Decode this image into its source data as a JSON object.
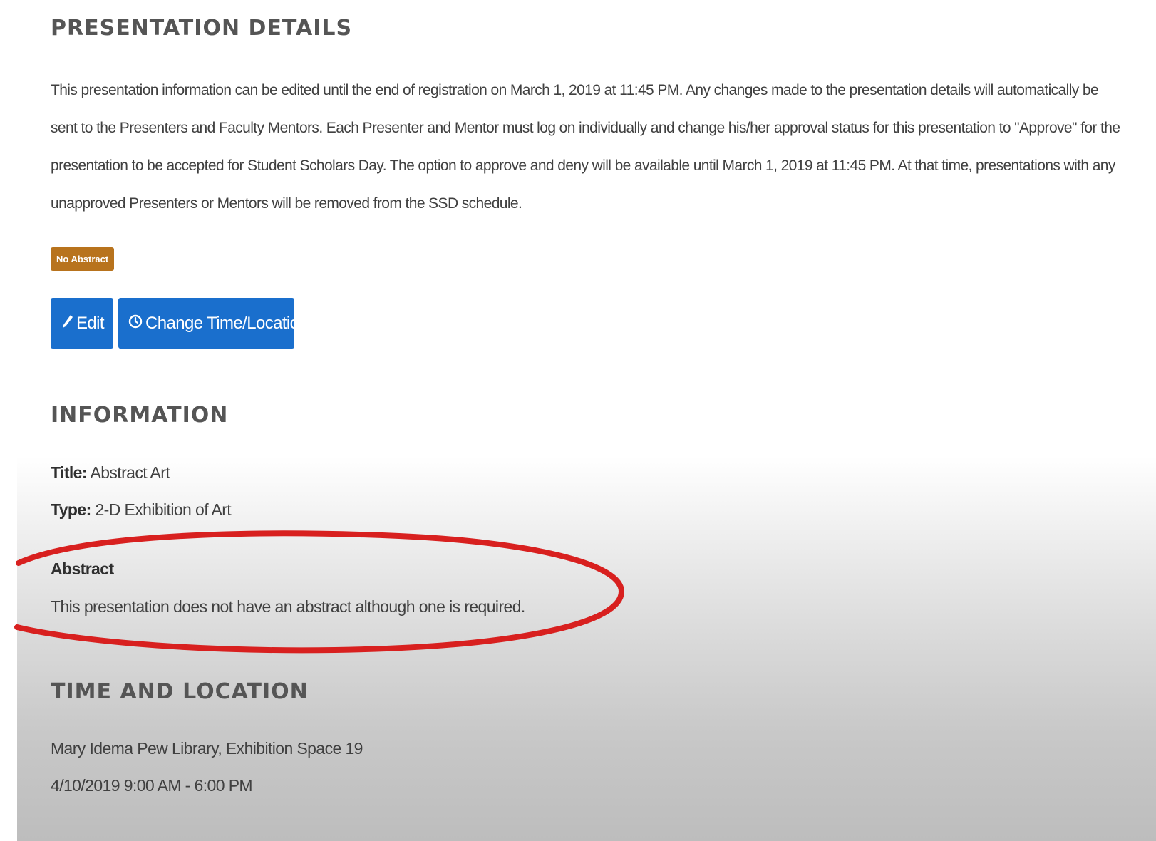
{
  "presentation_details": {
    "heading": "PRESENTATION DETAILS",
    "intro": "This presentation information can be edited until the end of registration on March 1, 2019 at 11:45 PM. Any changes made to the presentation details will automatically be sent to the Presenters and Faculty Mentors. Each Presenter and Mentor must log on individually and change his/her approval status for this presentation to \"Approve\" for the presentation to be accepted for Student Scholars Day. The option to approve and deny will be available until March 1, 2019 at 11:45 PM. At that time, presentations with any unapproved Presenters or Mentors will be removed from the SSD schedule.",
    "badge": "No Abstract",
    "badge_color": "#b8731d",
    "buttons": {
      "edit_label": "Edit",
      "edit_icon": "pencil-icon",
      "change_label": "Change Time/Location",
      "change_icon": "clock-icon",
      "color": "#1a6fcd"
    }
  },
  "information": {
    "heading": "INFORMATION",
    "title_label": "Title:",
    "title_value": "Abstract Art",
    "type_label": "Type:",
    "type_value": "2-D Exhibition of Art",
    "abstract_heading": "Abstract",
    "abstract_text": "This presentation does not have an abstract although one is required."
  },
  "time_location": {
    "heading": "TIME AND LOCATION",
    "location": "Mary Idema Pew Library, Exhibition Space 19",
    "datetime": "4/10/2019 9:00 AM - 6:00 PM"
  },
  "annotation": {
    "color": "#d8201f"
  }
}
